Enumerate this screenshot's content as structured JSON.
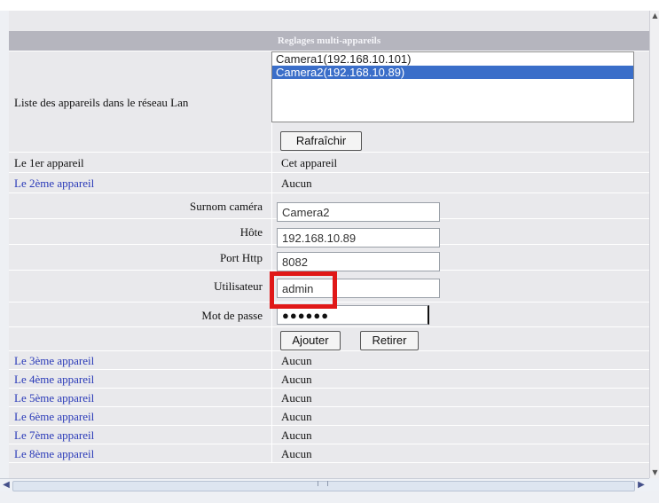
{
  "header": {
    "title": "Reglages multi-appareils"
  },
  "lan_list": {
    "label": "Liste des appareils dans le réseau Lan",
    "options": [
      "Camera1(192.168.10.101)",
      "Camera2(192.168.10.89)"
    ],
    "selected_index": 1,
    "refresh_label": "Rafraîchir"
  },
  "device1": {
    "label": "Le 1er appareil",
    "value": "Cet appareil"
  },
  "device2": {
    "label": "Le 2ème appareil",
    "value": "Aucun",
    "fields": {
      "alias_label": "Surnom caméra",
      "alias_value": "Camera2",
      "host_label": "Hôte",
      "host_value": "192.168.10.89",
      "port_label": "Port Http",
      "port_value": "8082",
      "user_label": "Utilisateur",
      "user_value": "admin",
      "password_label": "Mot de passe",
      "password_value": "●●●●●●"
    },
    "add_label": "Ajouter",
    "remove_label": "Retirer"
  },
  "other_devices": [
    {
      "label": "Le 3ème appareil",
      "value": "Aucun"
    },
    {
      "label": "Le 4ème appareil",
      "value": "Aucun"
    },
    {
      "label": "Le 5ème appareil",
      "value": "Aucun"
    },
    {
      "label": "Le 6ème appareil",
      "value": "Aucun"
    },
    {
      "label": "Le 7ème appareil",
      "value": "Aucun"
    },
    {
      "label": "Le 8ème appareil",
      "value": "Aucun"
    }
  ],
  "colors": {
    "highlight": "#e01818",
    "link": "#2a3ab8",
    "selection": "#3a6ec9"
  }
}
